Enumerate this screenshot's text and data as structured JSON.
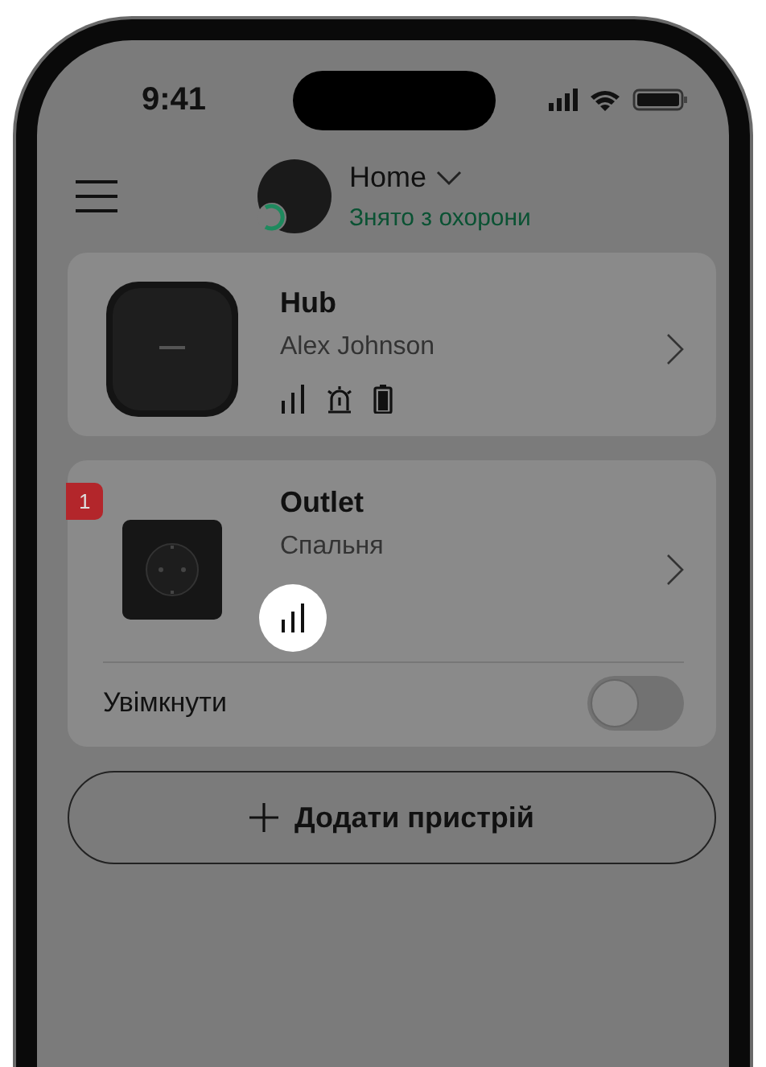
{
  "status_bar": {
    "time": "9:41"
  },
  "header": {
    "home_name": "Home",
    "arm_status": "Знято з охорони"
  },
  "devices": [
    {
      "kind": "hub",
      "name": "Hub",
      "subtitle": "Alex Johnson",
      "icons": [
        {
          "kind": "signal",
          "highlighted": false
        },
        {
          "kind": "siren",
          "highlighted": false
        },
        {
          "kind": "battery",
          "highlighted": false
        }
      ]
    },
    {
      "kind": "outlet",
      "name": "Outlet",
      "subtitle": "Спальня",
      "badge": "1",
      "icons": [
        {
          "kind": "signal",
          "highlighted": true
        }
      ],
      "toggle": {
        "label": "Увімкнути",
        "on": false
      }
    }
  ],
  "add_button": {
    "label": "Додати пристрій"
  }
}
